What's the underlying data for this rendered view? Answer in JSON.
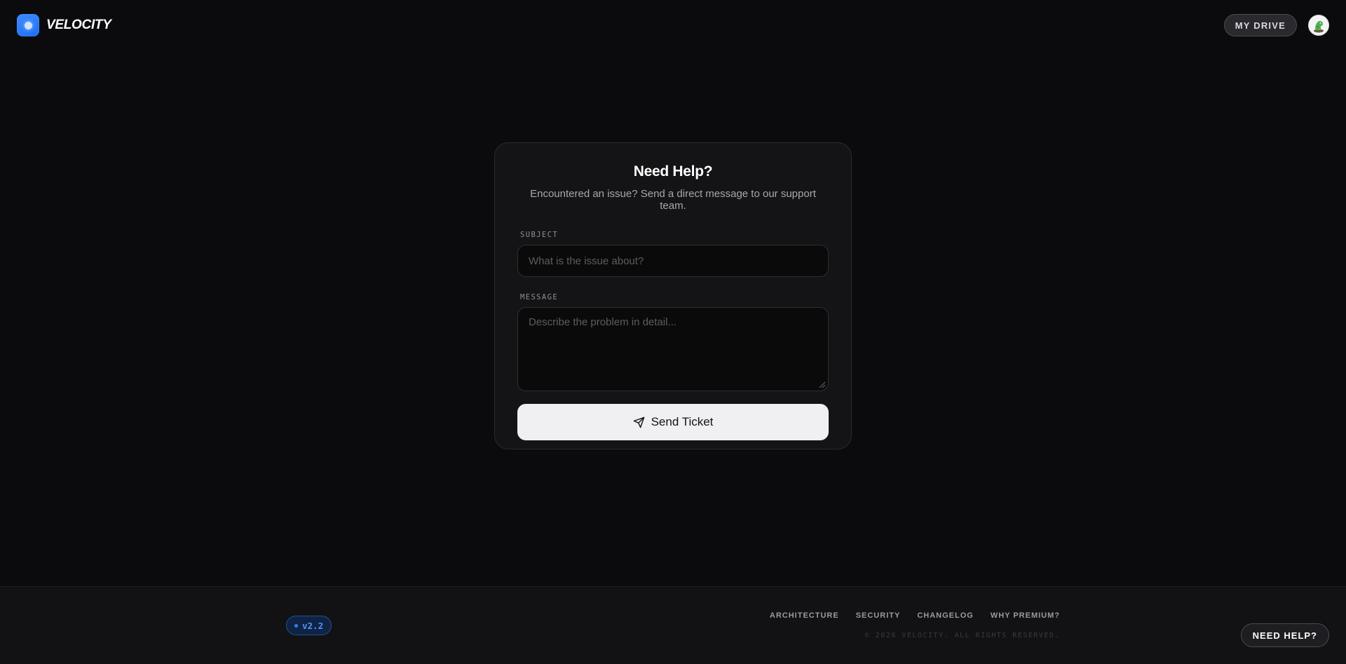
{
  "header": {
    "brand_name": "VELOCITY",
    "my_drive_label": "MY DRIVE"
  },
  "support_card": {
    "title": "Need Help?",
    "subtitle": "Encountered an issue? Send a direct message to our support team.",
    "subject_label": "SUBJECT",
    "subject_placeholder": "What is the issue about?",
    "subject_value": "",
    "message_label": "MESSAGE",
    "message_placeholder": "Describe the problem in detail...",
    "message_value": "",
    "send_label": "Send Ticket",
    "send_icon": "send-icon"
  },
  "footer": {
    "version": "v2.2",
    "links": [
      "ARCHITECTURE",
      "SECURITY",
      "CHANGELOG",
      "WHY PREMIUM?"
    ],
    "copyright": "© 2026 VELOCITY. ALL RIGHTS RESERVED."
  },
  "floating_help_label": "NEED HELP?",
  "colors": {
    "background": "#0b0b0d",
    "accent": "#2f80ff",
    "card": "#141416"
  }
}
